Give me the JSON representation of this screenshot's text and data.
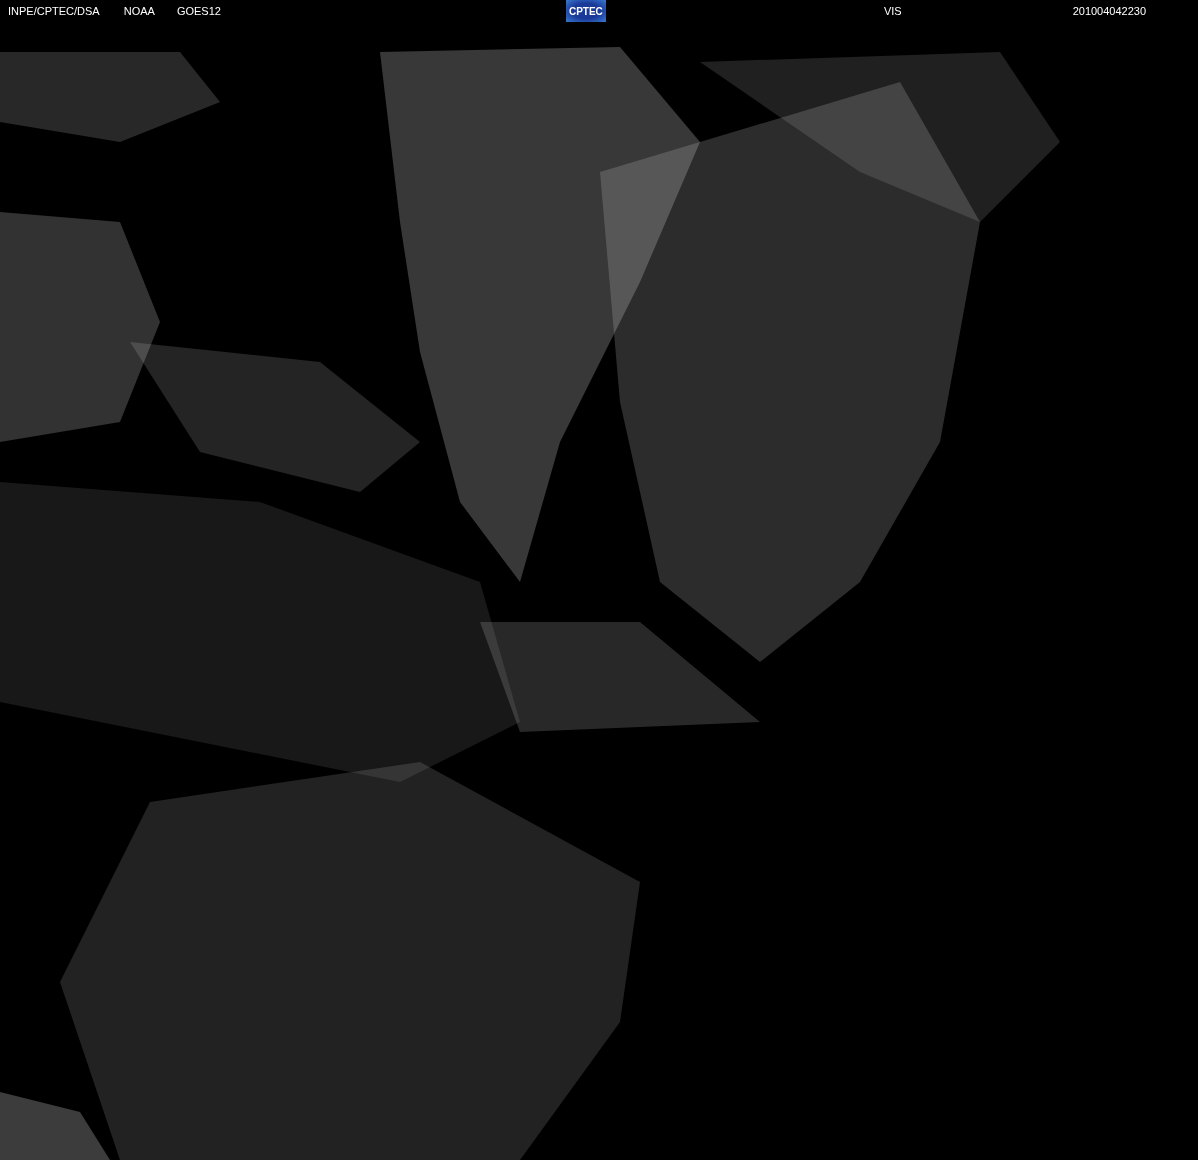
{
  "header": {
    "source": "INPE/CPTEC/DSA",
    "agency": "NOAA",
    "satellite": "GOES12",
    "logo": "CPTEC",
    "channel": "VIS",
    "timestamp": "201004042230"
  }
}
